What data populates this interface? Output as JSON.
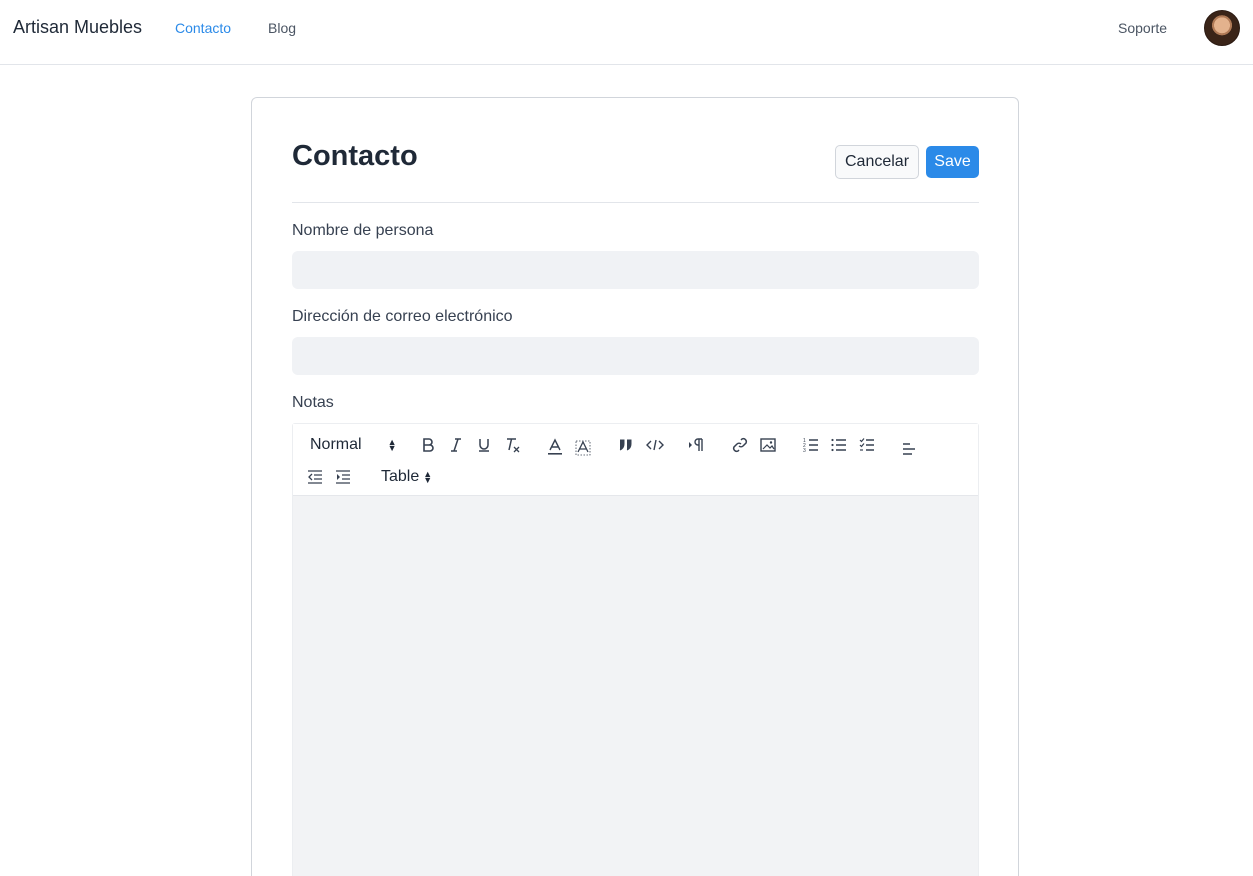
{
  "nav": {
    "brand": "Artisan Muebles",
    "links": [
      "Contacto",
      "Blog"
    ],
    "support": "Soporte",
    "active_color": "#2b8ae8"
  },
  "form": {
    "title": "Contacto",
    "cancel_label": "Cancelar",
    "save_label": "Save",
    "fields": {
      "name_label": "Nombre de persona",
      "name_value": "",
      "email_label": "Dirección de correo electrónico",
      "email_value": "",
      "notes_label": "Notas"
    },
    "editor": {
      "heading_select": "Normal",
      "table_select": "Table",
      "toolbar_icons": [
        "bold-icon",
        "italic-icon",
        "underline-icon",
        "clear-format-icon",
        "text-color-icon",
        "highlight-color-icon",
        "blockquote-icon",
        "code-icon",
        "paragraph-direction-icon",
        "link-icon",
        "image-icon",
        "ordered-list-icon",
        "bullet-list-icon",
        "checklist-icon",
        "align-left-icon",
        "outdent-icon",
        "indent-icon"
      ]
    }
  },
  "colors": {
    "primary": "#2b8ae8",
    "input_bg": "#f0f2f5"
  }
}
